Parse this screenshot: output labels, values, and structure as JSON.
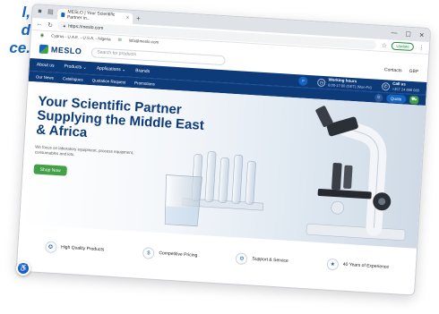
{
  "slogan": [
    "l,",
    "d",
    "ce."
  ],
  "browser": {
    "tab_title": "MESLO | Your Scientific Partner in...",
    "url": "https://meslo.com",
    "update_label": "Update",
    "window_controls": [
      "—",
      "☐",
      "✕"
    ]
  },
  "topstrip": {
    "countries": "Cyprus - U.A.E. - U.S.A. - Nigeria",
    "email": "info@meslo.com"
  },
  "header": {
    "logo": "MESLO",
    "search_placeholder": "Search for products",
    "contacts": "Contacts",
    "currency": "GBP"
  },
  "nav": {
    "items": [
      "About us",
      "Products ⌄",
      "Applications ⌄",
      "Brands",
      "Our News",
      "Catalogues",
      "Quotation Request",
      "Promotions"
    ],
    "working_hours_title": "Working hours",
    "working_hours_value": "8:00-17:00 (GET) (Mon-Fri)",
    "call_title": "Call us",
    "call_value": "+357 24 666 080",
    "quote_label": "Quote"
  },
  "hero": {
    "title": "Your Scientific Partner Supplying the Middle East & Africa",
    "text": "We focus on laboratory equipment, process equipment, consumables and kits.",
    "cta": "Shop Now"
  },
  "features": [
    {
      "icon": "award-icon",
      "label": "High Quality Products"
    },
    {
      "icon": "price-icon",
      "label": "Competitive Pricing"
    },
    {
      "icon": "support-icon",
      "label": "Support & Service"
    },
    {
      "icon": "experience-icon",
      "label": "40 Years of Experience"
    }
  ],
  "colors": {
    "primary": "#0d3b7a",
    "accent": "#1565c0",
    "green": "#43a047"
  }
}
